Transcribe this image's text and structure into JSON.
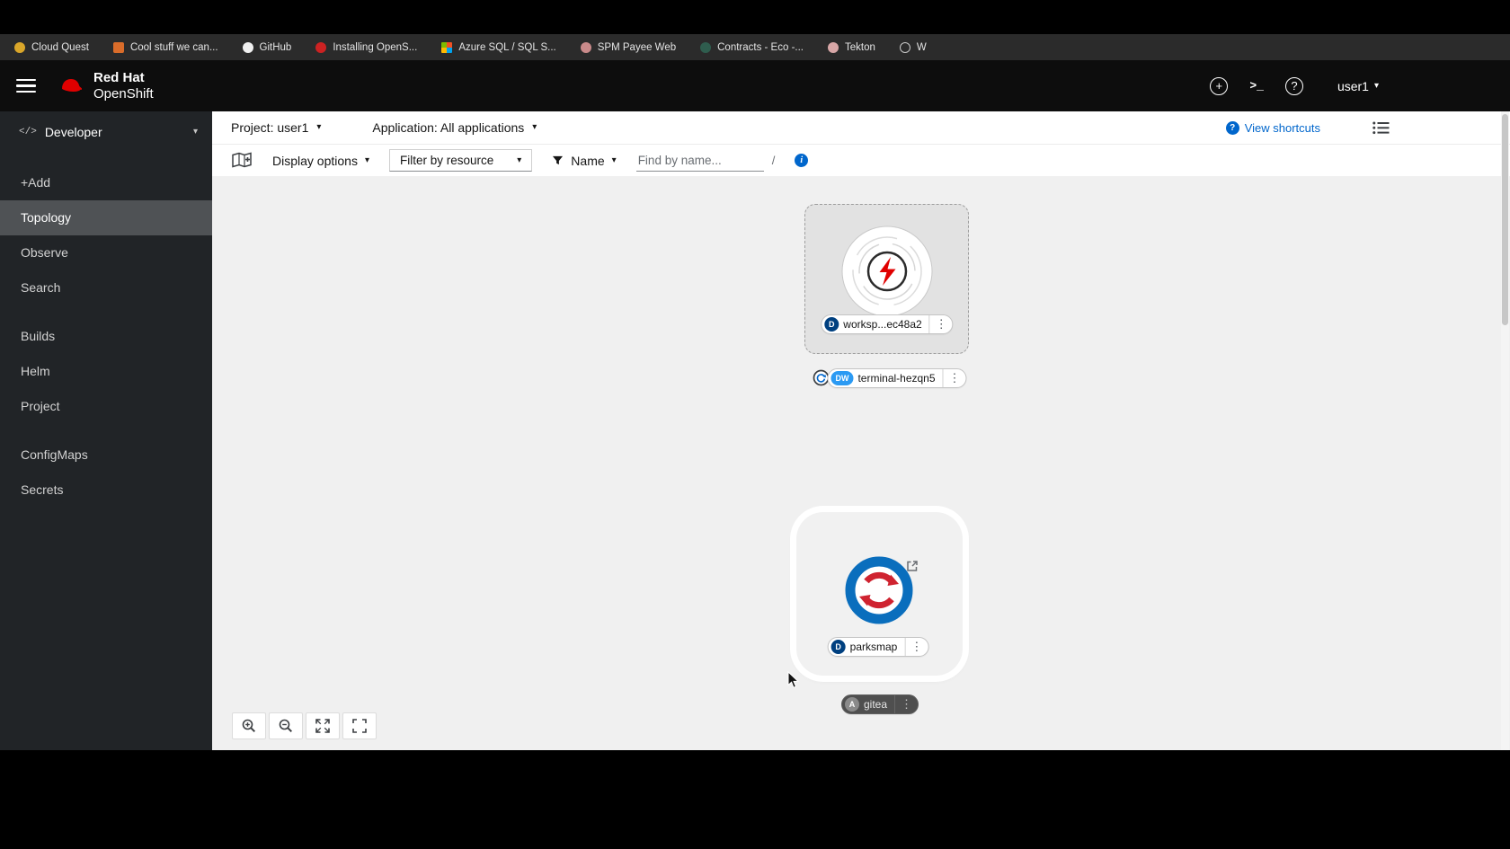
{
  "colors": {
    "accent": "#0066cc",
    "brand-red": "#e00000",
    "badge-deployment": "#004080",
    "badge-devworkspace": "#2b9af3",
    "badge-application": "#8a8a8a",
    "nav-selected": "#4f5255",
    "canvas-bg": "#f0f0f0"
  },
  "icons": {
    "caret_down": "▾",
    "kebab": "⋮",
    "code": "</>",
    "terminal_prompt": ">_",
    "plus": "+",
    "help": "?",
    "info": "i"
  },
  "bookmarks": {
    "items": [
      {
        "label": "Cloud Quest",
        "color": "#d9a62a"
      },
      {
        "label": "Cool stuff we can...",
        "color": "#d96c2a"
      },
      {
        "label": "GitHub",
        "color": "#f0f0f0"
      },
      {
        "label": "Installing OpenS...",
        "color": "#cc2222"
      },
      {
        "label": "Azure SQL / SQL S...",
        "color": ""
      },
      {
        "label": "SPM Payee Web",
        "color": "#c98a8a"
      },
      {
        "label": "Contracts - Eco -...",
        "color": "#2f5d4e"
      },
      {
        "label": "Tekton",
        "color": "#d8a7a7"
      },
      {
        "label": "W",
        "color": ""
      }
    ]
  },
  "masthead": {
    "brand_line1": "Red Hat",
    "brand_line2": "OpenShift",
    "user_menu": "user1"
  },
  "sidebar": {
    "perspective": "Developer",
    "items": [
      {
        "label": "+Add"
      },
      {
        "label": "Topology",
        "selected": true
      },
      {
        "label": "Observe"
      },
      {
        "label": "Search"
      },
      {
        "label": "Builds"
      },
      {
        "label": "Helm"
      },
      {
        "label": "Project"
      },
      {
        "label": "ConfigMaps"
      },
      {
        "label": "Secrets"
      }
    ]
  },
  "context_bar": {
    "project": "Project: user1",
    "application": "Application: All applications",
    "view_shortcuts": "View shortcuts"
  },
  "toolbar": {
    "display_options": "Display options",
    "filter_by_resource": "Filter by resource",
    "name_filter": "Name",
    "find_placeholder": "Find by name...",
    "shortcut_key": "/"
  },
  "topology": {
    "workspace_node": {
      "badge": "D",
      "label": "worksp...ec48a2"
    },
    "terminal_node": {
      "badge": "DW",
      "label": "terminal-hezqn5"
    },
    "parksmap_node": {
      "badge": "D",
      "label": "parksmap"
    },
    "gitea_node": {
      "badge": "A",
      "label": "gitea"
    }
  }
}
